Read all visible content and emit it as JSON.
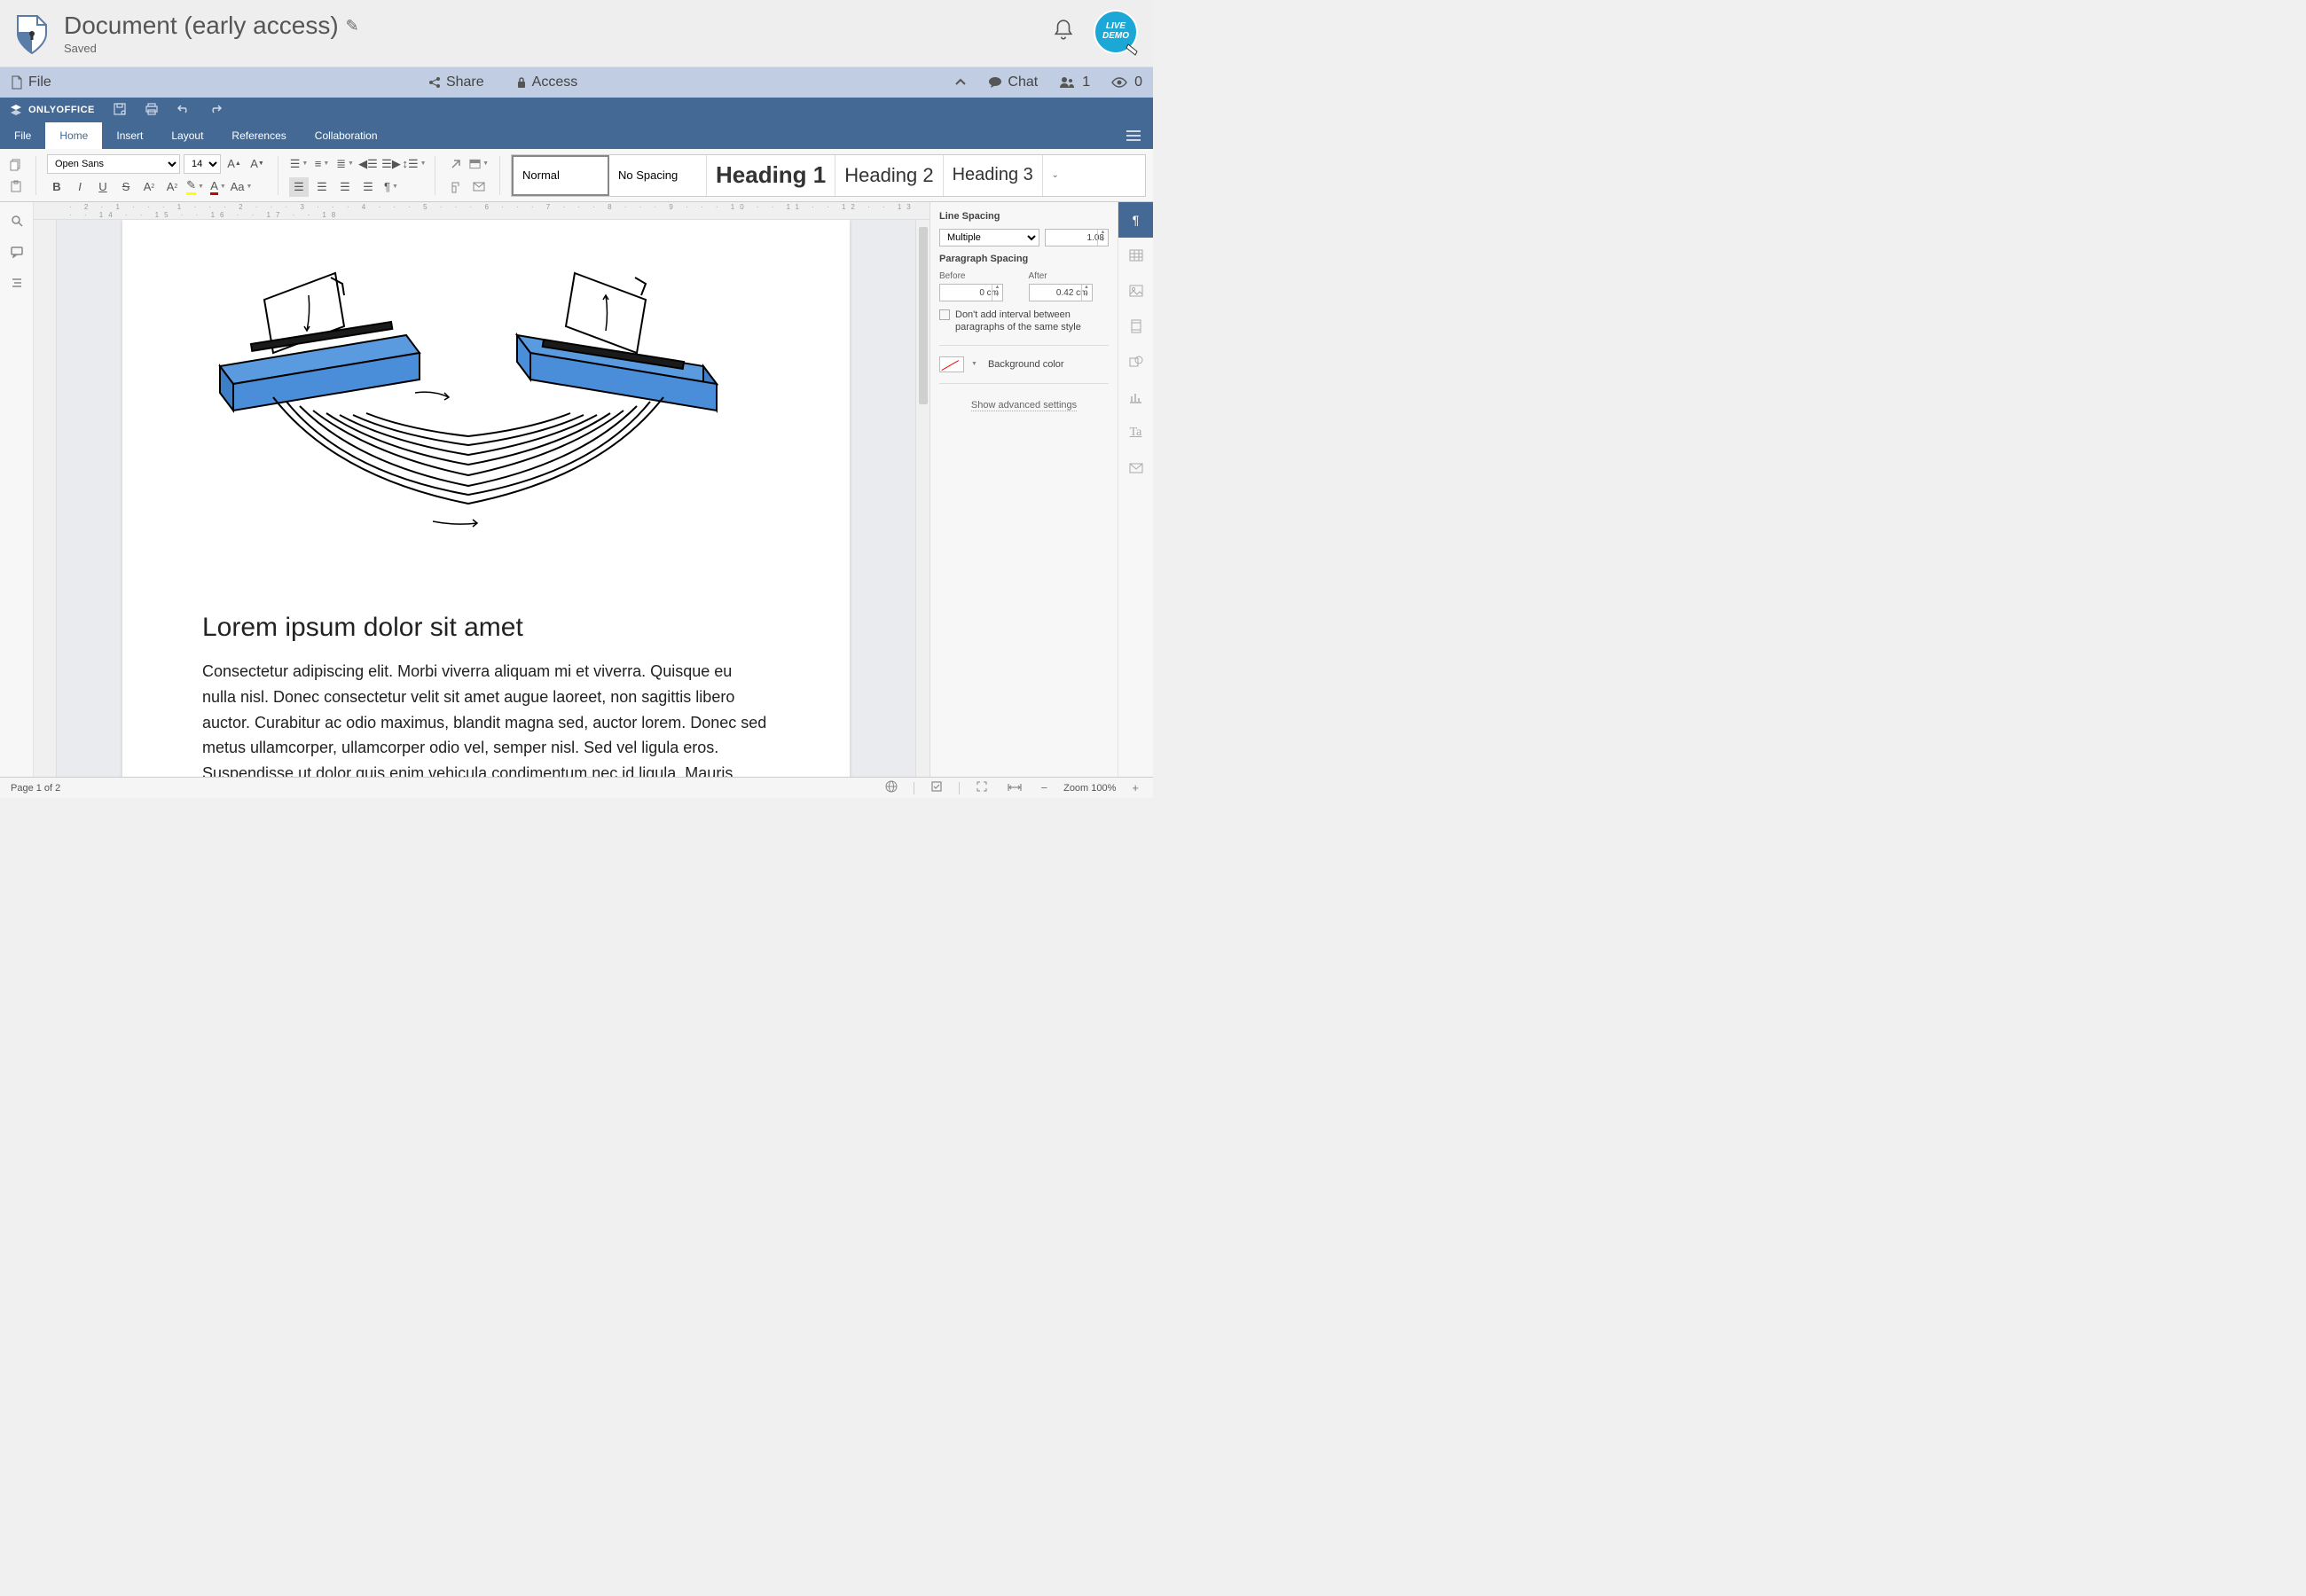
{
  "header": {
    "title": "Document (early access)",
    "status": "Saved"
  },
  "secbar": {
    "file": "File",
    "share": "Share",
    "access": "Access",
    "chat": "Chat",
    "users": "1",
    "viewers": "0"
  },
  "oo": {
    "brand": "ONLYOFFICE"
  },
  "menu": {
    "tabs": [
      "File",
      "Home",
      "Insert",
      "Layout",
      "References",
      "Collaboration"
    ],
    "active": 1
  },
  "ribbon": {
    "font": "Open Sans",
    "size": "14",
    "styles": [
      "Normal",
      "No Spacing",
      "Heading 1",
      "Heading 2",
      "Heading 3"
    ]
  },
  "rpanel": {
    "linespacing_label": "Line Spacing",
    "linespacing_mode": "Multiple",
    "linespacing_val": "1.08",
    "paraspacing_label": "Paragraph Spacing",
    "before_label": "Before",
    "before_val": "0 cm",
    "after_label": "After",
    "after_val": "0.42 cm",
    "nointerval": "Don't add interval between paragraphs of the same style",
    "bgcolor_label": "Background color",
    "adv": "Show advanced settings"
  },
  "doc": {
    "heading": "Lorem ipsum dolor sit amet",
    "body": "Consectetur adipiscing elit. Morbi viverra  aliquam mi et viverra. Quisque eu nulla nisl. Donec consectetur velit  sit amet augue laoreet, non sagittis libero auctor. Curabitur ac odio  maximus, blandit magna sed, auctor lorem. Donec sed metus ullamcorper,  ullamcorper odio vel, semper nisl. Sed vel ligula eros. Suspendisse ut  dolor quis enim vehicula condimentum nec id ligula. Mauris nunc"
  },
  "status": {
    "page": "Page 1 of 2",
    "zoom": "Zoom 100%"
  }
}
